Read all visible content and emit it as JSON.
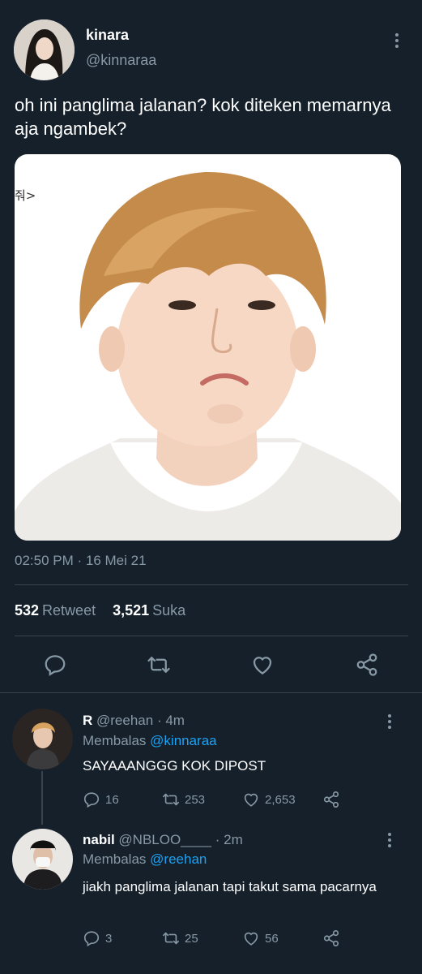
{
  "tweet": {
    "author_name": "kinara",
    "author_handle": "@kinnaraa",
    "text": "oh ini panglima jalanan? kok diteken memarnya aja ngambek?",
    "media_tag": "줘>",
    "timestamp": "02:50 PM · 16 Mei 21",
    "retweets_count": "532",
    "retweets_label": "Retweet",
    "likes_count": "3,521",
    "likes_label": "Suka"
  },
  "replies": [
    {
      "name": "R",
      "handle": "@reehan",
      "time": "· 4m",
      "replying_label": "Membalas",
      "replying_to": "@kinnaraa",
      "text": "SAYAAANGGG KOK DIPOST",
      "replies_count": "16",
      "retweets_count": "253",
      "likes_count": "2,653"
    },
    {
      "name": "nabil",
      "handle": "@NBLOO____",
      "time": "· 2m",
      "replying_label": "Membalas",
      "replying_to": "@reehan",
      "text": "jiakh panglima jalanan tapi takut sama pacarnya",
      "replies_count": "3",
      "retweets_count": "25",
      "likes_count": "56"
    }
  ],
  "colors": {
    "background": "#15202b",
    "divider": "#38444d",
    "muted": "#8899a6",
    "link": "#1da1f2"
  },
  "icons": [
    "more-icon",
    "reply-icon",
    "retweet-icon",
    "like-icon",
    "share-icon"
  ]
}
